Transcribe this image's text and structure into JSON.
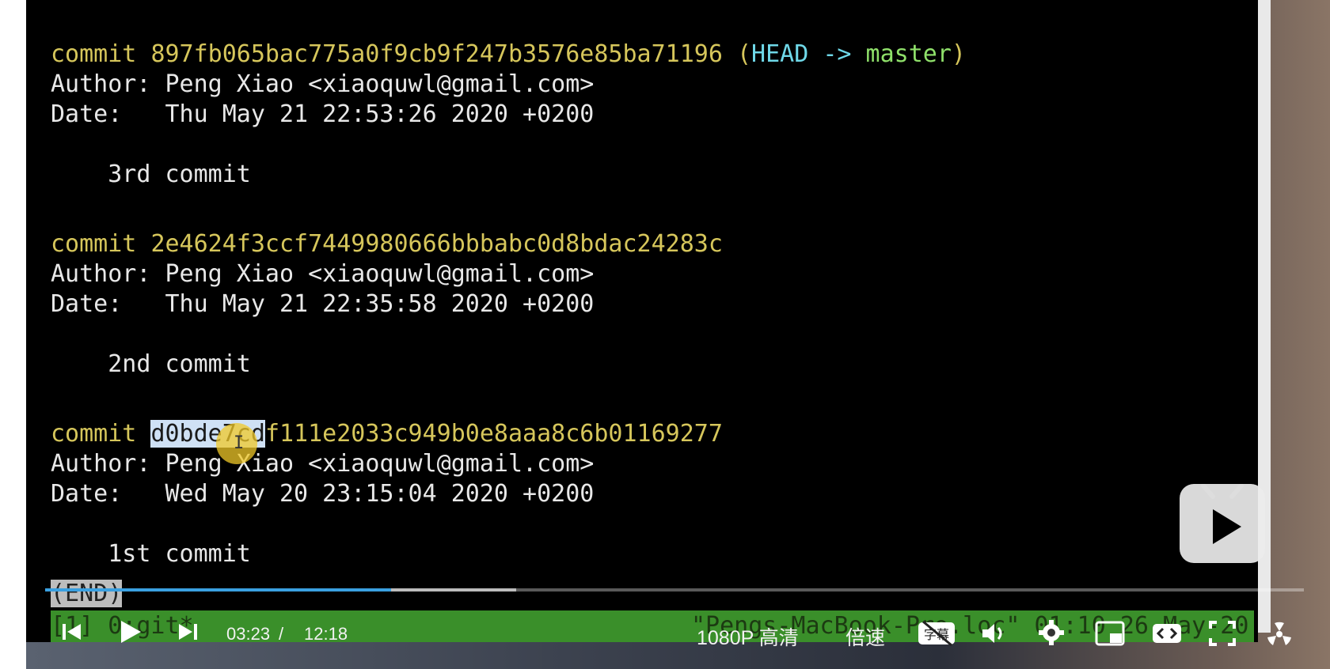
{
  "terminal": {
    "commits": [
      {
        "prefix": "commit ",
        "hash": "897fb065bac775a0f9cb9f247b3576e85ba71196",
        "ref_open": " (",
        "ref_head": "HEAD",
        "ref_arrow": " -> ",
        "ref_branch": "master",
        "ref_close": ")",
        "author": "Author: Peng Xiao <xiaoquwl@gmail.com>",
        "date": "Date:   Thu May 21 22:53:26 2020 +0200",
        "message": "    3rd commit"
      },
      {
        "prefix": "commit ",
        "hash": "2e4624f3ccf7449980666bbbabc0d8bdac24283c",
        "author": "Author: Peng Xiao <xiaoquwl@gmail.com>",
        "date": "Date:   Thu May 21 22:35:58 2020 +0200",
        "message": "    2nd commit"
      },
      {
        "prefix": "commit ",
        "hash_selected": "d0bde7cd",
        "hash_rest": "f111e2033c949b0e8aaa8c6b01169277",
        "author": "Author: Peng Xiao <xiaoquwl@gmail.com>",
        "date": "Date:   Wed May 20 23:15:04 2020 +0200",
        "message": "    1st commit"
      }
    ],
    "end_marker": "(END)",
    "status_left": "[1] 0:git*",
    "status_right": "\"Pengs-MacBook-Pro.loc\" 01:10 26-May-20"
  },
  "player": {
    "time_current": "03:23",
    "time_separator": "/",
    "time_total": "12:18",
    "quality": "1080P 高清",
    "speed": "倍速",
    "subtitle": "字幕",
    "progress_fraction": 0.275,
    "buffered_fraction": 0.374,
    "accent": "#3aa0e0"
  },
  "colors": {
    "hash": "#d6c65b",
    "head": "#6fd8e8",
    "branch": "#8fe06a",
    "tmux_status": "#3a8f2a"
  }
}
